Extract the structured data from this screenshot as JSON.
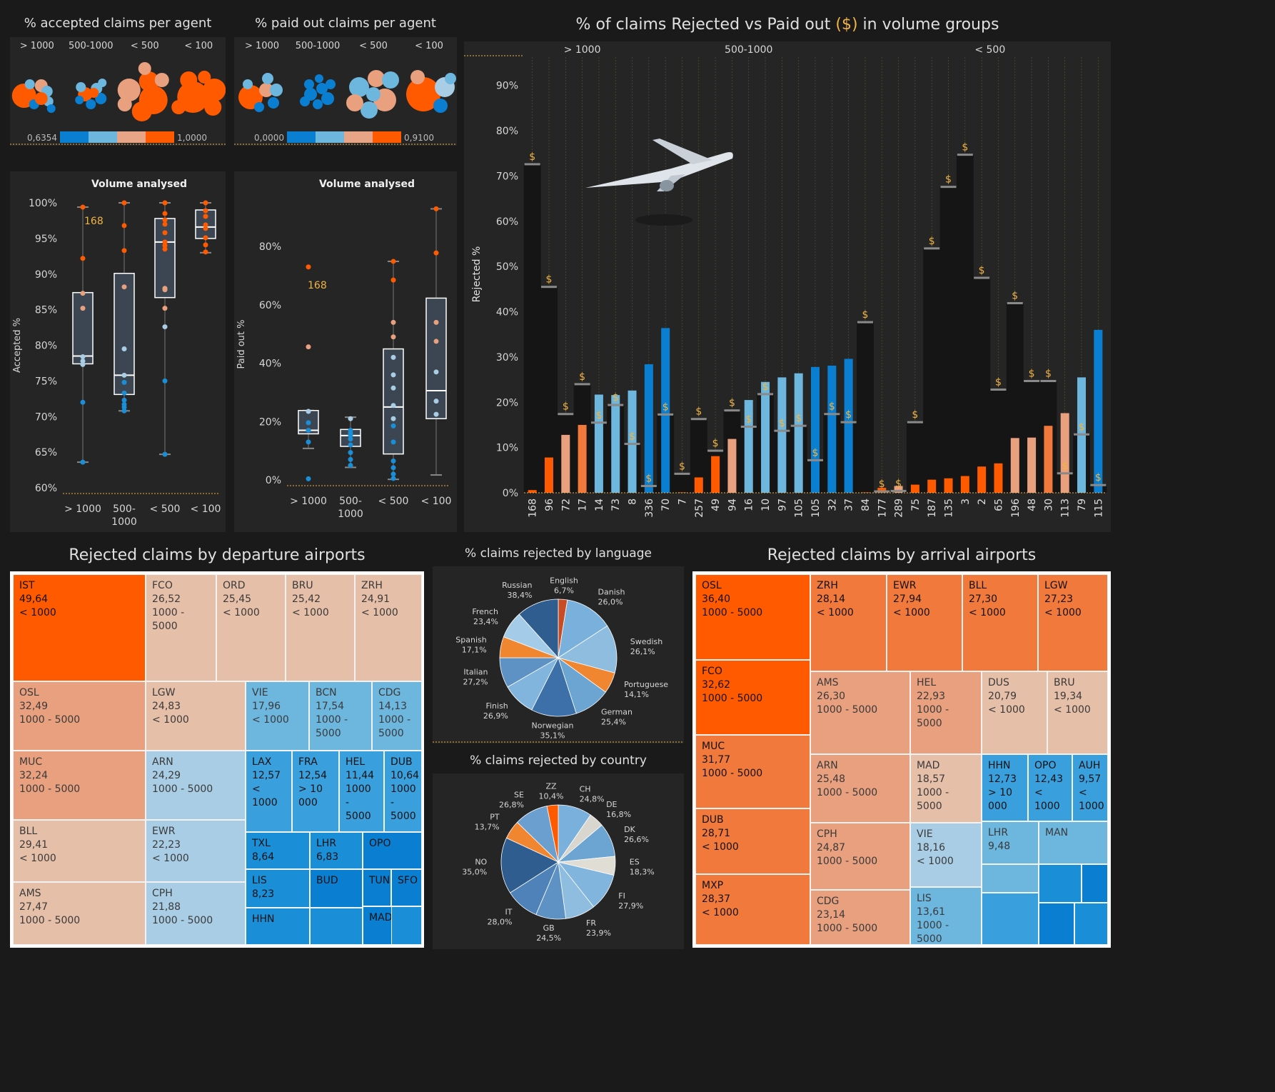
{
  "colors": {
    "bg": "#1a1a1a",
    "panel": "#252525",
    "accent": "#f0b443",
    "dark_orange": "#ff5a00",
    "orange": "#f2793c",
    "light_orange": "#e7a487",
    "peach": "#e6bfa9",
    "light_blue": "#a9cde4",
    "blue": "#6db6de",
    "mid_blue": "#3aa0dd",
    "dark_blue": "#0a7fd1"
  },
  "bubbles": {
    "accepted": {
      "title": "% accepted claims per agent",
      "groups": [
        "> 1000",
        "500-1000",
        "< 500",
        "< 100"
      ],
      "legend_min": "0,6354",
      "legend_max": "1,0000"
    },
    "paid": {
      "title": "% paid out claims per agent",
      "groups": [
        "> 1000",
        "500-1000",
        "< 500",
        "< 100"
      ],
      "legend_min": "0,0000",
      "legend_max": "0,9100"
    }
  },
  "box_accepted": {
    "title": "Volume analysed",
    "ylabel": "Accepted %",
    "yticks": [
      "100%",
      "95%",
      "90%",
      "85%",
      "80%",
      "75%",
      "70%",
      "65%",
      "60%"
    ],
    "groups": [
      {
        "label": "> 1000",
        "q1": 77.4,
        "median": 78.5,
        "q3": 87.4,
        "min": 63.6,
        "max": 99.4,
        "points": [
          99.4,
          92.2,
          87.3,
          85.2,
          78.4,
          77.8,
          77.3,
          72.0,
          63.6
        ]
      },
      {
        "label": "500-\n1000",
        "q1": 73.1,
        "median": 75.8,
        "q3": 90.1,
        "min": 70.8,
        "max": 100,
        "points": [
          100,
          96.8,
          93.3,
          88.2,
          79.5,
          75.8,
          74.8,
          73.3,
          72.3,
          71.7,
          71.3,
          70.8
        ]
      },
      {
        "label": "< 500",
        "q1": 86.7,
        "median": 94.5,
        "q3": 97.8,
        "min": 64.7,
        "max": 100,
        "points": [
          100,
          98.5,
          97.6,
          97.0,
          95.8,
          94.5,
          94.0,
          93.5,
          88.0,
          87.8,
          85.2,
          82.6,
          75.0,
          64.7
        ]
      },
      {
        "label": "< 100",
        "q1": 95.0,
        "median": 96.6,
        "q3": 99.0,
        "min": 93.0,
        "max": 100,
        "points": [
          100,
          98.9,
          98.1,
          96.9,
          96.4,
          95.1,
          94.1,
          93.1
        ]
      }
    ],
    "annotation": "168"
  },
  "box_paid": {
    "title": "Volume analysed",
    "ylabel": "Paid out %",
    "yticks": [
      "80%",
      "60%",
      "40%",
      "20%",
      "0%"
    ],
    "groups": [
      {
        "label": "> 1000",
        "q1": 15.8,
        "median": 17.0,
        "q3": 23.8,
        "min": 10.8,
        "max": 23.8,
        "points": [
          73.0,
          45.6,
          23.5,
          19.6,
          17.0,
          13.0,
          0.4
        ]
      },
      {
        "label": "500-\n1000",
        "q1": 11.5,
        "median": 15.2,
        "q3": 17.3,
        "min": 4.3,
        "max": 21.5,
        "points": [
          21.0,
          17.0,
          16.0,
          15.2,
          14.0,
          12.0,
          9.4,
          7.0,
          5.0
        ]
      },
      {
        "label": "< 500",
        "q1": 8.9,
        "median": 25.0,
        "q3": 44.9,
        "min": 0.2,
        "max": 74.9,
        "points": [
          74.9,
          68.5,
          54.0,
          49.0,
          42.0,
          36.0,
          31.5,
          25.5,
          21.0,
          18.5,
          13.0,
          6.5,
          4.2,
          2.0,
          0.5
        ]
      },
      {
        "label": "< 100",
        "q1": 21.0,
        "median": 30.6,
        "q3": 62.3,
        "min": 1.7,
        "max": 92.9,
        "points": [
          92.9,
          77.8,
          54.0,
          47.5,
          37.0,
          27.0,
          22.5
        ]
      }
    ],
    "annotation": "168"
  },
  "chart_data": {
    "type": "bar",
    "title": "% of claims Rejected vs Paid out ($) in volume groups",
    "ylabel": "Rejected %",
    "ylim": [
      0,
      95
    ],
    "yticks": [
      "0%",
      "10%",
      "20%",
      "30%",
      "40%",
      "50%",
      "60%",
      "70%",
      "80%",
      "90%"
    ],
    "groups": [
      {
        "label": "> 1000",
        "from": 0,
        "to": 6
      },
      {
        "label": "500-1000",
        "from": 7,
        "to": 19
      },
      {
        "label": "< 500",
        "from": 20,
        "to": 35
      }
    ],
    "categories": [
      "168",
      "96",
      "72",
      "17",
      "14",
      "73",
      "8",
      "336",
      "70",
      "7",
      "257",
      "49",
      "94",
      "16",
      "10",
      "97",
      "105",
      "105",
      "32",
      "37",
      "84",
      "177",
      "289",
      "75",
      "187",
      "135",
      "3",
      "2",
      "65",
      "196",
      "48",
      "30",
      "113",
      "79",
      "115"
    ],
    "rejected": [
      0.6,
      7.8,
      12.8,
      15.0,
      21.7,
      21.6,
      22.6,
      28.4,
      36.4,
      0.1,
      3.4,
      8.1,
      11.9,
      20.5,
      24.5,
      25.5,
      26.4,
      27.8,
      28.1,
      29.6,
      0.1,
      1.1,
      1.5,
      1.8,
      2.9,
      3.2,
      3.7,
      5.8,
      6.5,
      12.1,
      12.2,
      14.8,
      17.6,
      25.5,
      36.0
    ],
    "paid_out": [
      72.6,
      45.5,
      17.4,
      24.0,
      15.5,
      19.4,
      10.8,
      1.5,
      17.3,
      4.2,
      16.3,
      9.3,
      18.2,
      14.6,
      21.8,
      13.7,
      14.8,
      7.2,
      17.4,
      15.6,
      37.7,
      0.3,
      0.4,
      15.6,
      54.0,
      67.6,
      74.7,
      47.5,
      22.8,
      41.9,
      24.7,
      24.7,
      4.3,
      12.9,
      1.7
    ],
    "paid_label": "$"
  },
  "dep_treemap": {
    "title": "Rejected claims by departure airports",
    "cells": [
      {
        "code": "IST",
        "value": "49,64",
        "vol": "< 1000",
        "c": "#ff5a00"
      },
      {
        "code": "FCO",
        "value": "26,52",
        "vol": "1000 - 5000",
        "c": "#e6bfa9"
      },
      {
        "code": "ORD",
        "value": "25,45",
        "vol": "< 1000",
        "c": "#e6bfa9"
      },
      {
        "code": "BRU",
        "value": "25,42",
        "vol": "< 1000",
        "c": "#e6bfa9"
      },
      {
        "code": "ZRH",
        "value": "24,91",
        "vol": "< 1000",
        "c": "#e6bfa9"
      },
      {
        "code": "OSL",
        "value": "32,49",
        "vol": "1000 - 5000",
        "c": "#e8a07e"
      },
      {
        "code": "LGW",
        "value": "24,83",
        "vol": "< 1000",
        "c": "#e6bfa9"
      },
      {
        "code": "VIE",
        "value": "17,96",
        "vol": "< 1000",
        "c": "#6db6de"
      },
      {
        "code": "BCN",
        "value": "17,54",
        "vol": "1000 - 5000",
        "c": "#6db6de"
      },
      {
        "code": "CDG",
        "value": "14,13",
        "vol": "1000 - 5000",
        "c": "#6db6de"
      },
      {
        "code": "MUC",
        "value": "32,24",
        "vol": "1000 - 5000",
        "c": "#e8a07e"
      },
      {
        "code": "ARN",
        "value": "24,29",
        "vol": "1000 - 5000",
        "c": "#a9cde4"
      },
      {
        "code": "LAX",
        "value": "12,57",
        "vol": "< 1000",
        "c": "#3aa0dd"
      },
      {
        "code": "FRA",
        "value": "12,54",
        "vol": "> 10 000",
        "c": "#3aa0dd"
      },
      {
        "code": "HEL",
        "value": "11,44",
        "vol": "1000 - 5000",
        "c": "#3aa0dd"
      },
      {
        "code": "DUB",
        "value": "10,64",
        "vol": "1000 - 5000",
        "c": "#3aa0dd"
      },
      {
        "code": "BLL",
        "value": "29,41",
        "vol": "< 1000",
        "c": "#e6bfa9"
      },
      {
        "code": "EWR",
        "value": "22,23",
        "vol": "< 1000",
        "c": "#a9cde4"
      },
      {
        "code": "TXL",
        "value": "8,64",
        "vol": "",
        "c": "#1a8fd8"
      },
      {
        "code": "LHR",
        "value": "6,83",
        "vol": "",
        "c": "#1a8fd8"
      },
      {
        "code": "OPO",
        "value": "",
        "vol": "",
        "c": "#0a7fd1"
      },
      {
        "code": "LIS",
        "value": "8,23",
        "vol": "",
        "c": "#1a8fd8"
      },
      {
        "code": "BUD",
        "value": "",
        "vol": "",
        "c": "#0a7fd1"
      },
      {
        "code": "TUN",
        "value": "",
        "vol": "",
        "c": "#0a7fd1"
      },
      {
        "code": "SFO",
        "value": "",
        "vol": "",
        "c": "#0a7fd1"
      },
      {
        "code": "AMS",
        "value": "27,47",
        "vol": "1000 - 5000",
        "c": "#e6bfa9"
      },
      {
        "code": "CPH",
        "value": "21,88",
        "vol": "1000 - 5000",
        "c": "#a9cde4"
      },
      {
        "code": "HHN",
        "value": "",
        "vol": "",
        "c": "#1a8fd8"
      },
      {
        "code": "MAD",
        "value": "",
        "vol": "",
        "c": "#0a7fd1"
      }
    ]
  },
  "arr_treemap": {
    "title": "Rejected claims by arrival airports",
    "cells": [
      {
        "code": "OSL",
        "value": "36,40",
        "vol": "1000 - 5000",
        "c": "#ff5a00"
      },
      {
        "code": "ZRH",
        "value": "28,14",
        "vol": "< 1000",
        "c": "#f2793c"
      },
      {
        "code": "EWR",
        "value": "27,94",
        "vol": "< 1000",
        "c": "#f2793c"
      },
      {
        "code": "BLL",
        "value": "27,30",
        "vol": "< 1000",
        "c": "#f2793c"
      },
      {
        "code": "LGW",
        "value": "27,23",
        "vol": "< 1000",
        "c": "#f2793c"
      },
      {
        "code": "FCO",
        "value": "32,62",
        "vol": "1000 - 5000",
        "c": "#ff5a00"
      },
      {
        "code": "AMS",
        "value": "26,30",
        "vol": "1000 - 5000",
        "c": "#e8a07e"
      },
      {
        "code": "HEL",
        "value": "22,93",
        "vol": "1000 - 5000",
        "c": "#e8a07e"
      },
      {
        "code": "DUS",
        "value": "20,79",
        "vol": "< 1000",
        "c": "#e6bfa9"
      },
      {
        "code": "BRU",
        "value": "19,34",
        "vol": "< 1000",
        "c": "#e6bfa9"
      },
      {
        "code": "MUC",
        "value": "31,77",
        "vol": "1000 - 5000",
        "c": "#f2793c"
      },
      {
        "code": "ARN",
        "value": "25,48",
        "vol": "1000 - 5000",
        "c": "#e8a07e"
      },
      {
        "code": "MAD",
        "value": "18,57",
        "vol": "1000 - 5000",
        "c": "#e6bfa9"
      },
      {
        "code": "HHN",
        "value": "12,73",
        "vol": "> 10 000",
        "c": "#3aa0dd"
      },
      {
        "code": "OPO",
        "value": "12,43",
        "vol": "< 1000",
        "c": "#3aa0dd"
      },
      {
        "code": "AUH",
        "value": "9,57",
        "vol": "< 1000",
        "c": "#3aa0dd"
      },
      {
        "code": "DUB",
        "value": "28,71",
        "vol": "< 1000",
        "c": "#f2793c"
      },
      {
        "code": "CPH",
        "value": "24,87",
        "vol": "1000 - 5000",
        "c": "#e8a07e"
      },
      {
        "code": "VIE",
        "value": "18,16",
        "vol": "< 1000",
        "c": "#a9cde4"
      },
      {
        "code": "LHR",
        "value": "9,48",
        "vol": "",
        "c": "#6db6de"
      },
      {
        "code": "MAN",
        "value": "",
        "vol": "",
        "c": "#6db6de"
      },
      {
        "code": "MXP",
        "value": "28,37",
        "vol": "< 1000",
        "c": "#f2793c"
      },
      {
        "code": "CDG",
        "value": "23,14",
        "vol": "1000 - 5000",
        "c": "#e8a07e"
      },
      {
        "code": "LIS",
        "value": "13,61",
        "vol": "1000 - 5000",
        "c": "#6db6de"
      }
    ]
  },
  "pie_language": {
    "title": "% claims rejected by language",
    "slices": [
      {
        "name": "English",
        "value": "6,7%",
        "w": 3,
        "c": "#c84b24"
      },
      {
        "name": "Danish",
        "value": "26,0%",
        "w": 16,
        "c": "#7ab1dc"
      },
      {
        "name": "Swedish",
        "value": "26,1%",
        "w": 16,
        "c": "#8fbde0"
      },
      {
        "name": "Portuguese",
        "value": "14,1%",
        "w": 7,
        "c": "#f0862f"
      },
      {
        "name": "German",
        "value": "25,4%",
        "w": 12,
        "c": "#6da5d2"
      },
      {
        "name": "Norwegian",
        "value": "35,1%",
        "w": 15,
        "c": "#3d6fa8"
      },
      {
        "name": "Finish",
        "value": "26,9%",
        "w": 11,
        "c": "#82b5dd"
      },
      {
        "name": "Italian",
        "value": "27,2%",
        "w": 10,
        "c": "#5e92c4"
      },
      {
        "name": "Spanish",
        "value": "17,1%",
        "w": 7,
        "c": "#f0862f"
      },
      {
        "name": "French",
        "value": "23,4%",
        "w": 9,
        "c": "#a4cbe8"
      },
      {
        "name": "Russian",
        "value": "38,4%",
        "w": 14,
        "c": "#2f5d8f"
      }
    ]
  },
  "pie_country": {
    "title": "% claims rejected by country",
    "slices": [
      {
        "name": "CH",
        "value": "24,8%",
        "w": 9,
        "c": "#7ab1dc"
      },
      {
        "name": "DE",
        "value": "16,8%",
        "w": 4,
        "c": "#d9d6cf"
      },
      {
        "name": "DK",
        "value": "26,6%",
        "w": 9,
        "c": "#6da5d2"
      },
      {
        "name": "ES",
        "value": "18,3%",
        "w": 5,
        "c": "#e0ddd5"
      },
      {
        "name": "FI",
        "value": "27,9%",
        "w": 10,
        "c": "#82b5dd"
      },
      {
        "name": "FR",
        "value": "23,9%",
        "w": 8,
        "c": "#8fbde0"
      },
      {
        "name": "GB",
        "value": "24,5%",
        "w": 8,
        "c": "#5e92c4"
      },
      {
        "name": "IT",
        "value": "28,0%",
        "w": 9,
        "c": "#4f82b8"
      },
      {
        "name": "NO",
        "value": "35,0%",
        "w": 15,
        "c": "#2f5d8f"
      },
      {
        "name": "PT",
        "value": "13,7%",
        "w": 5,
        "c": "#f0862f"
      },
      {
        "name": "SE",
        "value": "26,8%",
        "w": 9,
        "c": "#6b9fd0"
      },
      {
        "name": "ZZ",
        "value": "10,4%",
        "w": 3,
        "c": "#ff5a00"
      }
    ]
  }
}
